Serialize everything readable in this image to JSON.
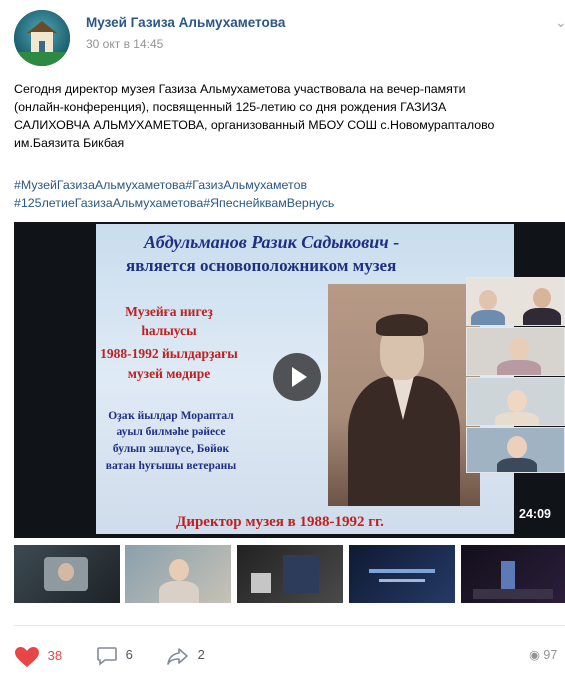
{
  "post": {
    "group_name": "Музей Газиза Альмухаметова",
    "date": "30 окт в 14:45",
    "menu_icon": "more-dots-icon",
    "text_lines": [
      "Сегодня директор музея Газиза Альмухаметова участвовала на вечер-памяти",
      "(онлайн-конференция), посвященный 125-летию со дня рождения ГАЗИЗА",
      "САЛИХОВЧА АЛЬМУХАМЕТОВА, организованный МБОУ СОШ с.Новомурапталово",
      "им.Баязита Бикбая"
    ],
    "hashtag_lines": [
      "#МузейГазизаАльмухаметова#ГазизАльмухаметов",
      "#125летиеГазизаАльмухаметова#ЯпеснейквамВернусь"
    ]
  },
  "video": {
    "slide_title": "Абдульманов Разик Садыкович  -",
    "slide_subtitle": "является основоположником  музея",
    "red_lines": [
      "Музейға нигеҙ",
      "һалыусы",
      "1988-1992 йылдарҙағы",
      "музей мөдире"
    ],
    "blue_lines": [
      "Оҙаҡ йылдар Мораптал",
      "ауыл билмәһе рәйесе",
      "булып эшләүсе, Бөйөк",
      "ватан һуғышы ветераны"
    ],
    "bottom_line": "Директор музея в 1988-1992 гг.",
    "duration": "24:09",
    "play_icon": "play-icon"
  },
  "footer": {
    "likes": "38",
    "comments": "6",
    "shares": "2",
    "views": "97",
    "like_icon": "heart-icon",
    "comment_icon": "comment-icon",
    "share_icon": "share-icon",
    "views_icon": "eye-icon",
    "like_color": "#e64646"
  }
}
